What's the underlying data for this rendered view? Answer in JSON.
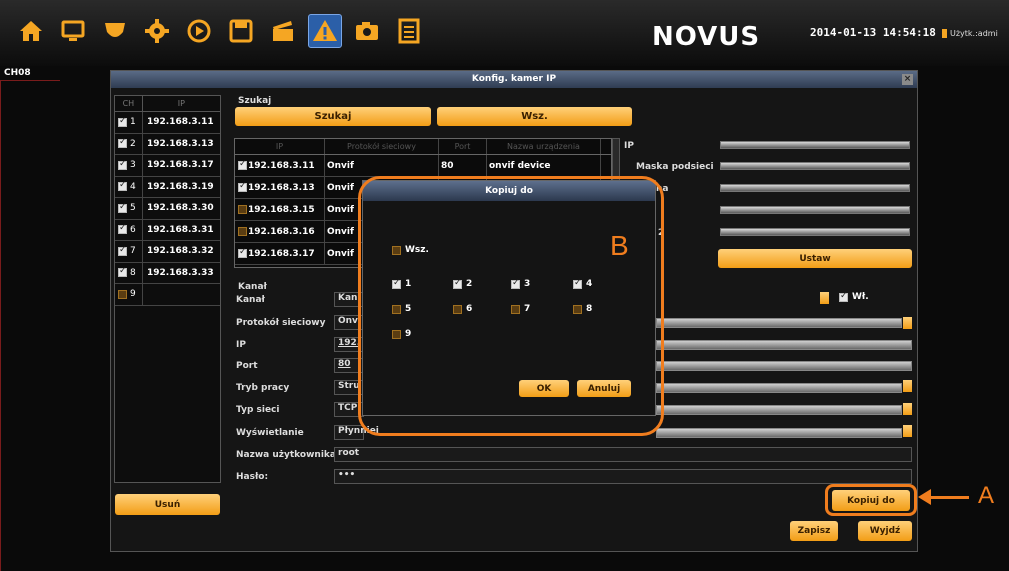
{
  "toolbar": {
    "icons": [
      "home-icon",
      "monitor-icon",
      "camera-icon",
      "gear-icon",
      "play-icon",
      "save-icon",
      "clapper-icon",
      "alarm-icon",
      "photo-camera-icon",
      "document-icon"
    ],
    "active_icon": "alarm-icon",
    "logo": "NOVUS",
    "datetime": "2014-01-13 14:54:18",
    "user": "Użytk.:admi"
  },
  "channel_label": "CH08",
  "window": {
    "title": "Konfig. kamer IP",
    "close": "×",
    "channel_table": {
      "headers": [
        "CH",
        "IP"
      ],
      "rows": [
        {
          "ch": "1",
          "ip": "192.168.3.11",
          "checked": true
        },
        {
          "ch": "2",
          "ip": "192.168.3.13",
          "checked": true
        },
        {
          "ch": "3",
          "ip": "192.168.3.17",
          "checked": true
        },
        {
          "ch": "4",
          "ip": "192.168.3.19",
          "checked": true
        },
        {
          "ch": "5",
          "ip": "192.168.3.30",
          "checked": true
        },
        {
          "ch": "6",
          "ip": "192.168.3.31",
          "checked": true
        },
        {
          "ch": "7",
          "ip": "192.168.3.32",
          "checked": true
        },
        {
          "ch": "8",
          "ip": "192.168.3.33",
          "checked": true
        },
        {
          "ch": "9",
          "ip": "",
          "checked": false
        }
      ]
    },
    "search": {
      "section_label": "Szukaj",
      "search_button": "Szukaj",
      "all_button": "Wsz.",
      "headers": [
        "IP",
        "Protokół sieciowy",
        "Port",
        "Nazwa urządzenia"
      ],
      "rows": [
        {
          "ip": "192.168.3.11",
          "protocol": "Onvif",
          "port": "80",
          "name": "onvif device",
          "checked": true
        },
        {
          "ip": "192.168.3.13",
          "protocol": "Onvif",
          "port": "",
          "name": "",
          "checked": true
        },
        {
          "ip": "192.168.3.15",
          "protocol": "Onvif",
          "port": "",
          "name": "",
          "checked": false
        },
        {
          "ip": "192.168.3.16",
          "protocol": "Onvif",
          "port": "",
          "name": "",
          "checked": false
        },
        {
          "ip": "192.168.3.17",
          "protocol": "Onvif",
          "port": "",
          "name": "",
          "checked": true
        }
      ]
    },
    "network": {
      "ip_label": "IP",
      "mask_label": "Maska podsieci",
      "gateway_partial": "na",
      "dns_partial": "2",
      "set_button": "Ustaw"
    },
    "form": {
      "section_label": "Kanał",
      "fields": [
        {
          "label": "Kanał",
          "value": "Kan"
        },
        {
          "label": "Protokół sieciowy",
          "value": "Onv"
        },
        {
          "label": "IP",
          "value": "192."
        },
        {
          "label": "Port",
          "value": "80"
        },
        {
          "label": "Tryb pracy",
          "value": "Stru"
        },
        {
          "label": "Typ sieci",
          "value": "TCP"
        },
        {
          "label": "Wyświetlanie",
          "value": "Płynniej"
        },
        {
          "label": "Nazwa użytkownika",
          "value": "root"
        },
        {
          "label": "Hasło:",
          "value": "•••"
        }
      ],
      "enable_label": "Wł.",
      "enable_checked": true
    },
    "buttons": {
      "delete": "Usuń",
      "copy_to": "Kopiuj do",
      "save": "Zapisz",
      "exit": "Wyjdź"
    }
  },
  "dialog": {
    "title": "Kopiuj do",
    "all_label": "Wsz.",
    "all_checked": false,
    "channels": [
      {
        "label": "1",
        "checked": true
      },
      {
        "label": "2",
        "checked": true
      },
      {
        "label": "3",
        "checked": true
      },
      {
        "label": "4",
        "checked": true
      },
      {
        "label": "5",
        "checked": false
      },
      {
        "label": "6",
        "checked": false
      },
      {
        "label": "7",
        "checked": false
      },
      {
        "label": "8",
        "checked": false
      },
      {
        "label": "9",
        "checked": false
      }
    ],
    "ok": "OK",
    "cancel": "Anuluj"
  },
  "annotations": {
    "a": "A",
    "b": "B",
    "color": "#f07d1e"
  }
}
